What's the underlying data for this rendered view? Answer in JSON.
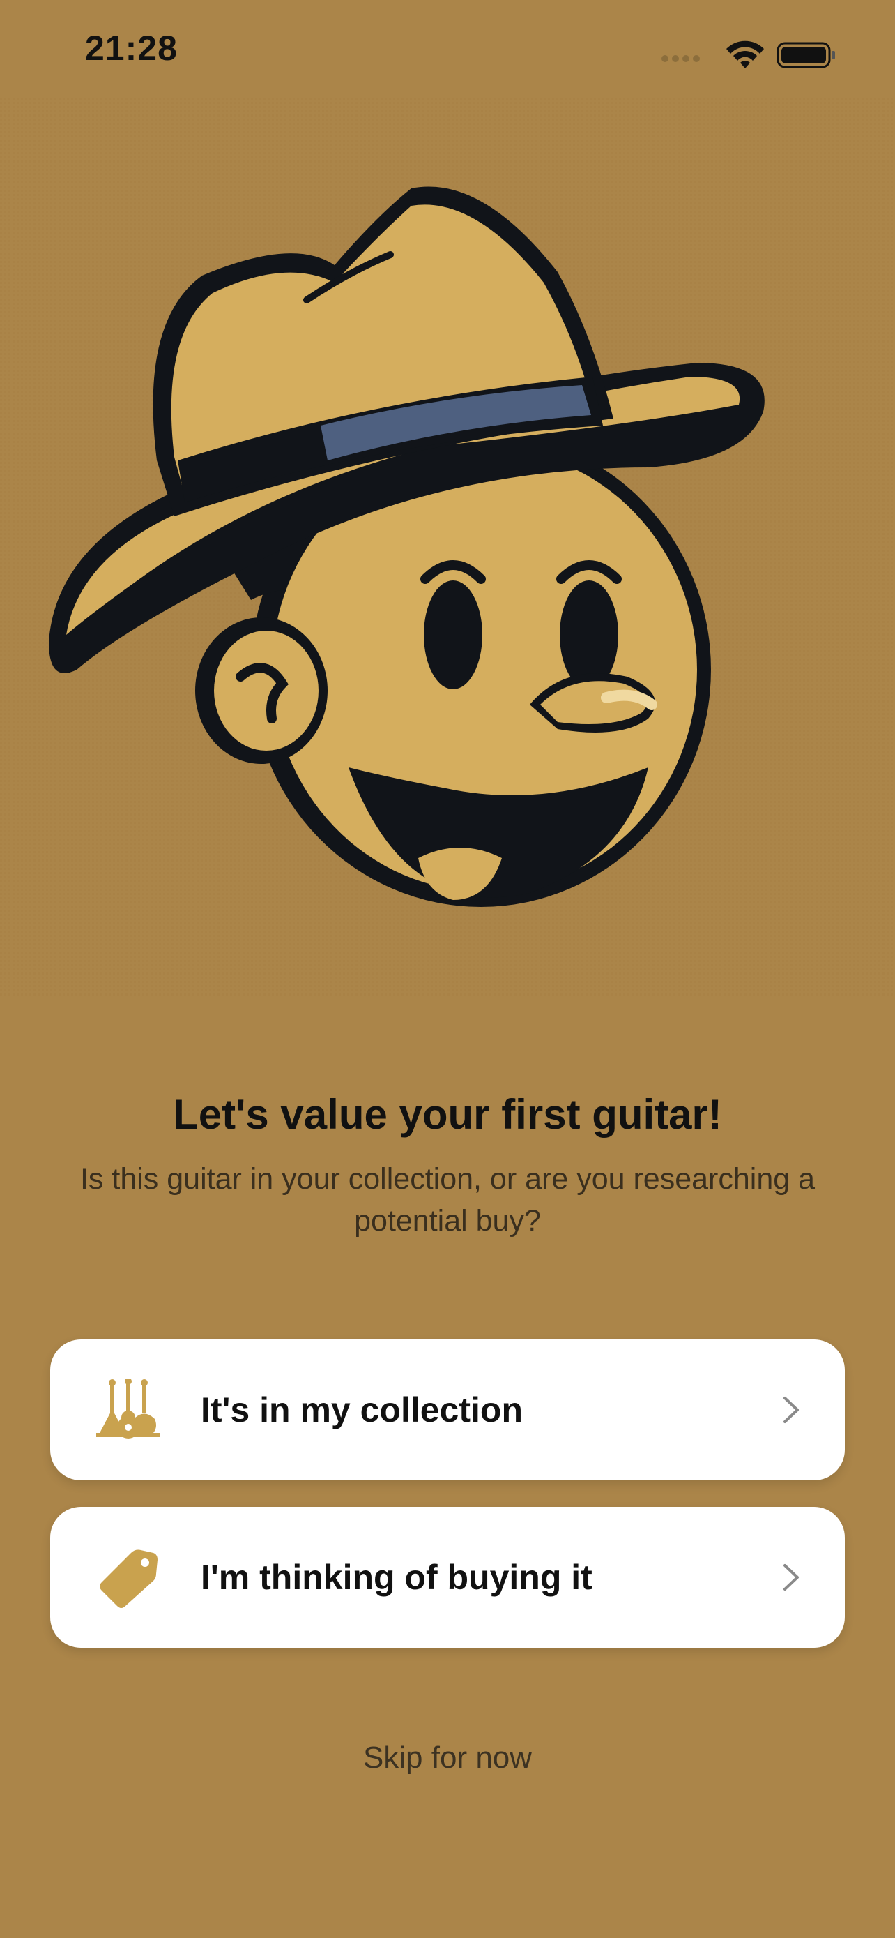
{
  "status_bar": {
    "time": "21:28",
    "icons": [
      "signal-icon",
      "wifi-icon",
      "battery-icon"
    ]
  },
  "hero": {
    "illustration": "mascot-man-with-fedora"
  },
  "onboarding": {
    "title": "Let's value your first guitar!",
    "subtitle": "Is this guitar in your collection, or are you researching a potential buy?"
  },
  "options": [
    {
      "label": "It's in my collection",
      "icon": "guitars-icon"
    },
    {
      "label": "I'm thinking of buying it",
      "icon": "price-tag-icon"
    }
  ],
  "skip_label": "Skip for now",
  "colors": {
    "background": "#AB8549",
    "accent": "#C9A24E",
    "card": "#FFFFFF",
    "text": "#111111"
  }
}
